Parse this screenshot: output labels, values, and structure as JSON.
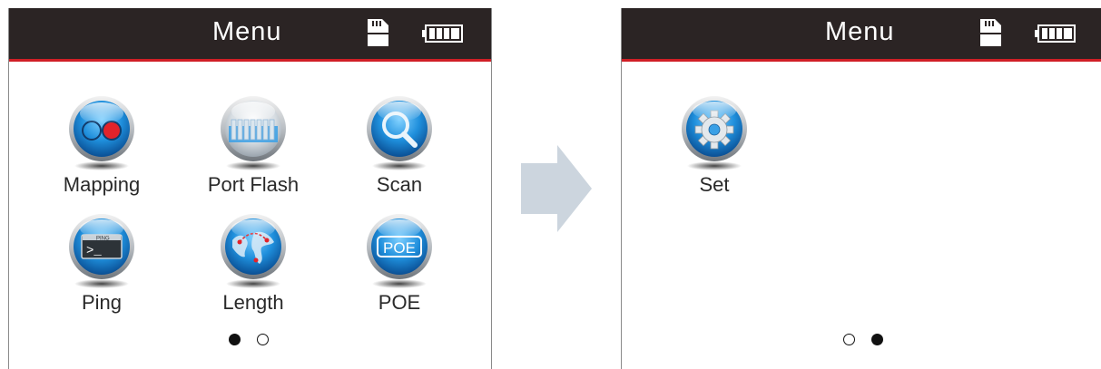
{
  "screens": [
    {
      "header": {
        "title": "Menu",
        "sd_icon": "sd-card-icon",
        "battery_icon": "battery-full-icon"
      },
      "menu_items": [
        {
          "label": "Mapping",
          "icon": "mapping-icon"
        },
        {
          "label": "Port Flash",
          "icon": "port-flash-icon"
        },
        {
          "label": "Scan",
          "icon": "scan-magnifier-icon"
        },
        {
          "label": "Ping",
          "icon": "ping-terminal-icon"
        },
        {
          "label": "Length",
          "icon": "length-globe-icon"
        },
        {
          "label": "POE",
          "icon": "poe-icon"
        }
      ],
      "page_indicator": {
        "current": 1,
        "total": 2
      }
    },
    {
      "header": {
        "title": "Menu",
        "sd_icon": "sd-card-icon",
        "battery_icon": "battery-full-icon"
      },
      "menu_items": [
        {
          "label": "Set",
          "icon": "settings-gear-icon"
        }
      ],
      "page_indicator": {
        "current": 2,
        "total": 2
      }
    }
  ],
  "icon_texts": {
    "ping_badge": "PING",
    "ping_prompt": ">_",
    "poe_badge": "POE"
  },
  "transition_icon": "right-arrow-icon",
  "colors": {
    "header_bg": "#2b2424",
    "header_accent": "#d01f26",
    "icon_blue": "#1f8fdc",
    "arrow": "#ccd5de"
  }
}
